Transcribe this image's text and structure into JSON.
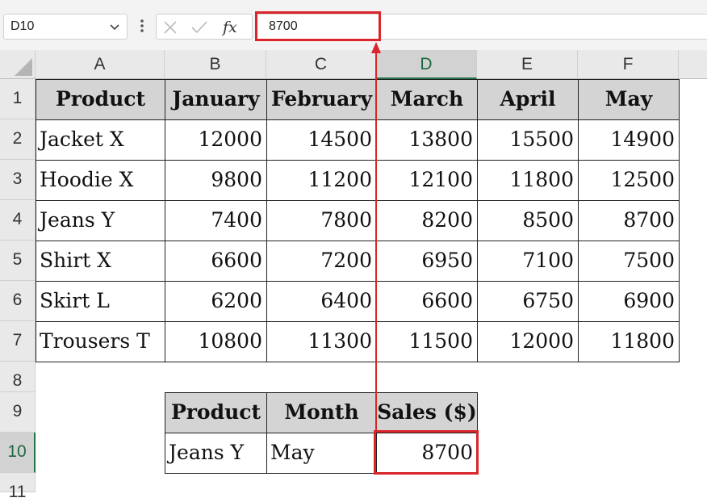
{
  "formula_bar": {
    "name_box": "D10",
    "formula_value": "8700",
    "fx_label": "fx"
  },
  "sheet": {
    "columns": [
      "A",
      "B",
      "C",
      "D",
      "E",
      "F"
    ],
    "rows": [
      "1",
      "2",
      "3",
      "4",
      "5",
      "6",
      "7",
      "8",
      "9",
      "10",
      "11"
    ],
    "selected_column": "D",
    "selected_row": "10"
  },
  "sales_table": {
    "headers": [
      "Product",
      "January",
      "February",
      "March",
      "April",
      "May"
    ],
    "rows": [
      [
        "Jacket X",
        "12000",
        "14500",
        "13800",
        "15500",
        "14900"
      ],
      [
        "Hoodie X",
        "9800",
        "11200",
        "12100",
        "11800",
        "12500"
      ],
      [
        "Jeans Y",
        "7400",
        "7800",
        "8200",
        "8500",
        "8700"
      ],
      [
        "Shirt X",
        "6600",
        "7200",
        "6950",
        "7100",
        "7500"
      ],
      [
        "Skirt L",
        "6200",
        "6400",
        "6600",
        "6750",
        "6900"
      ],
      [
        "Trousers T",
        "10800",
        "11300",
        "11500",
        "12000",
        "11800"
      ]
    ]
  },
  "lookup_table": {
    "headers": [
      "Product",
      "Month",
      "Sales ($)"
    ],
    "row": [
      "Jeans Y",
      "May",
      "8700"
    ]
  },
  "annotation": {
    "color": "#d9252b"
  }
}
